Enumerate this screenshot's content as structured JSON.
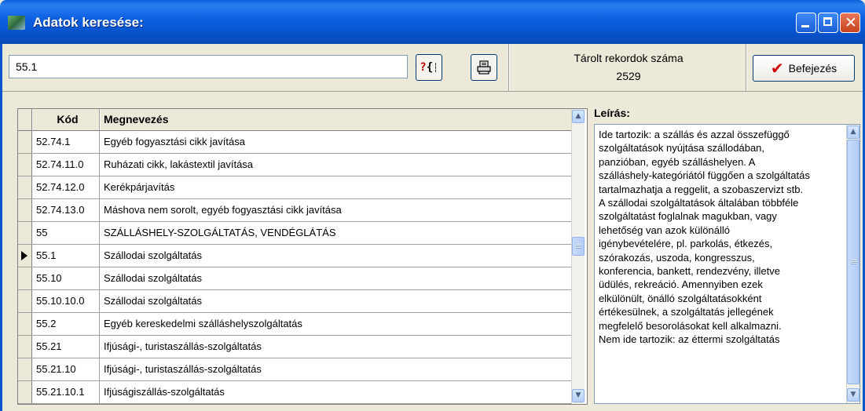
{
  "window": {
    "title": "Adatok keresése:",
    "icon": "app-icon"
  },
  "search": {
    "value": "55.1"
  },
  "toolbar": {
    "help_icon": "help-code-icon",
    "print_icon": "printer-icon"
  },
  "records": {
    "label": "Tárolt rekordok száma",
    "count": "2529"
  },
  "finish": {
    "label": "Befejezés",
    "icon": "checkmark-icon",
    "icon_color": "#d00000"
  },
  "grid": {
    "headers": {
      "code": "Kód",
      "name": "Megnevezés"
    },
    "rows": [
      {
        "code": "52.74.1",
        "name": "Egyéb fogyasztási cikk javítása"
      },
      {
        "code": "52.74.11.0",
        "name": "Ruházati cikk, lakástextil javítása"
      },
      {
        "code": "52.74.12.0",
        "name": "Kerékpárjavítás"
      },
      {
        "code": "52.74.13.0",
        "name": "Máshova nem sorolt, egyéb fogyasztási cikk javítása"
      },
      {
        "code": "55",
        "name": "SZÁLLÁSHELY-SZOLGÁLTATÁS, VENDÉGLÁTÁS"
      },
      {
        "code": "55.1",
        "name": "Szállodai szolgáltatás",
        "selected": true
      },
      {
        "code": "55.10",
        "name": "Szállodai szolgáltatás"
      },
      {
        "code": "55.10.10.0",
        "name": "Szállodai szolgáltatás"
      },
      {
        "code": "55.2",
        "name": "Egyéb kereskedelmi szálláshelyszolgáltatás"
      },
      {
        "code": "55.21",
        "name": "Ifjúsági-, turistaszállás-szolgáltatás"
      },
      {
        "code": "55.21.10",
        "name": "Ifjúsági-, turistaszállás-szolgáltatás"
      },
      {
        "code": "55.21.10.1",
        "name": "Ifjúságiszállás-szolgáltatás"
      }
    ]
  },
  "description": {
    "label": "Leírás:",
    "text": "Ide tartozik: a szállás és azzal összefüggő\nszolgáltatások nyújtása szállodában,\npanzióban, egyéb szálláshelyen. A\nszálláshely-kategóriától függően a szolgáltatás\ntartalmazhatja a reggelit, a szobaszervizt stb.\nA szállodai szolgáltatások általában többféle\nszolgáltatást foglalnak magukban, vagy\nlehetőség van azok különálló\nigénybevételére, pl. parkolás, étkezés,\nszórakozás, uszoda, kongresszus,\nkonferencia, bankett, rendezvény, illetve\nüdülés, rekreáció. Amennyiben ezek\nelkülönült, önálló szolgáltatásokként\nértékesülnek, a szolgáltatás jellegének\nmegfelelő besorolásokat kell alkalmazni.\nNem ide tartozik: az éttermi szolgáltatás"
  }
}
